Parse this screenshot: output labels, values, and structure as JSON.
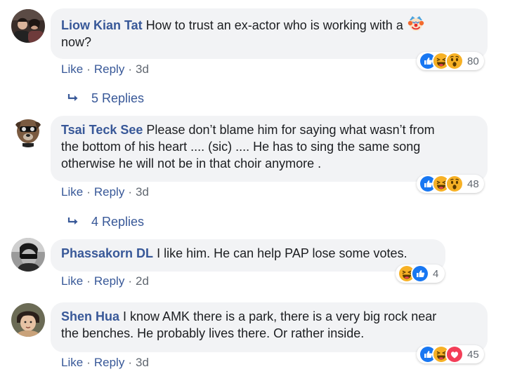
{
  "comments": [
    {
      "name": "Liow Kian Tat",
      "text_before": "How to trust an ex-actor who is working with a",
      "inline_emoji": "clown-emoji",
      "text_after": "now?",
      "reactions": [
        "like",
        "haha",
        "wow"
      ],
      "reaction_count": "80",
      "actions": {
        "like": "Like",
        "reply": "Reply",
        "time": "3d"
      },
      "replies_label": "5 Replies"
    },
    {
      "name": "Tsai Teck See",
      "text_line1": "Please don’t blame him for saying what wasn’t from",
      "text_line2": "the bottom of his heart .... (sic) .... He has to sing the same song",
      "text_line3": "otherwise he will not be in that choir anymore .",
      "reactions": [
        "like",
        "haha",
        "wow"
      ],
      "reaction_count": "48",
      "actions": {
        "like": "Like",
        "reply": "Reply",
        "time": "3d"
      },
      "replies_label": "4 Replies"
    },
    {
      "name": "Phassakorn DL",
      "text": "I like him. He can help PAP lose some votes.",
      "reactions": [
        "haha",
        "like"
      ],
      "reaction_count": "4",
      "actions": {
        "like": "Like",
        "reply": "Reply",
        "time": "2d"
      }
    },
    {
      "name": "Shen Hua",
      "text_line1": "I know AMK there is a park, there is a very big rock near",
      "text_line2": "the benches. He probably lives there. Or rather inside.",
      "reactions": [
        "like",
        "haha",
        "love"
      ],
      "reaction_count": "45",
      "actions": {
        "like": "Like",
        "reply": "Reply",
        "time": "3d"
      }
    }
  ],
  "separator": "·",
  "colors": {
    "name": "#385898",
    "bubble": "#f2f3f5",
    "meta": "#606770",
    "like": "#1877f2",
    "haha": "#f7b125",
    "love": "#f33e58"
  }
}
